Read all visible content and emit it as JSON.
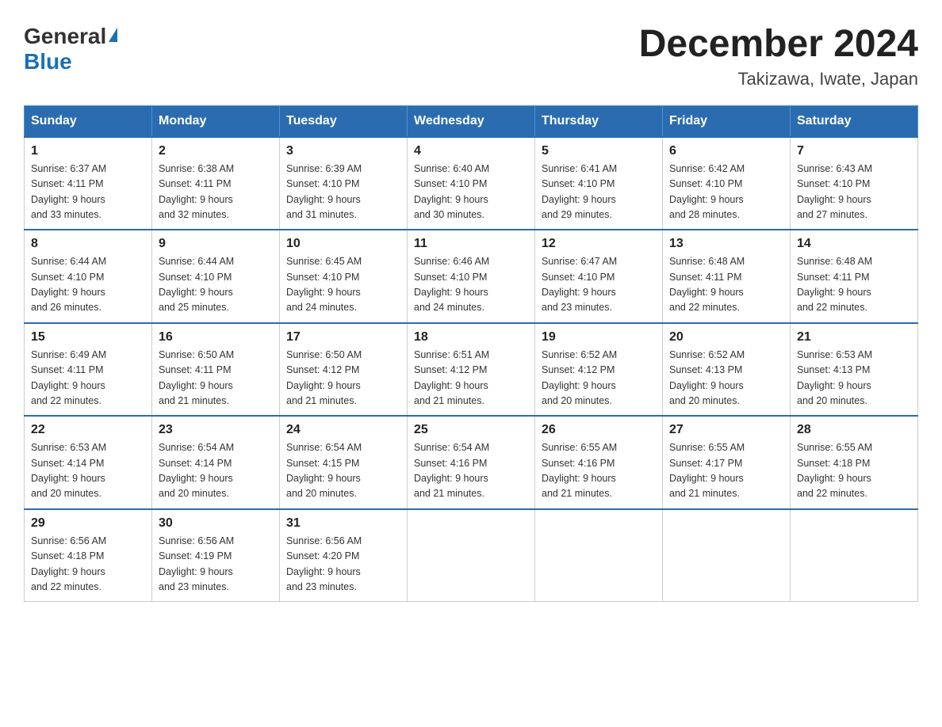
{
  "header": {
    "logo_general": "General",
    "logo_blue": "Blue",
    "month_year": "December 2024",
    "location": "Takizawa, Iwate, Japan"
  },
  "days_of_week": [
    "Sunday",
    "Monday",
    "Tuesday",
    "Wednesday",
    "Thursday",
    "Friday",
    "Saturday"
  ],
  "weeks": [
    [
      {
        "day": "1",
        "sunrise": "6:37 AM",
        "sunset": "4:11 PM",
        "daylight": "9 hours and 33 minutes."
      },
      {
        "day": "2",
        "sunrise": "6:38 AM",
        "sunset": "4:11 PM",
        "daylight": "9 hours and 32 minutes."
      },
      {
        "day": "3",
        "sunrise": "6:39 AM",
        "sunset": "4:10 PM",
        "daylight": "9 hours and 31 minutes."
      },
      {
        "day": "4",
        "sunrise": "6:40 AM",
        "sunset": "4:10 PM",
        "daylight": "9 hours and 30 minutes."
      },
      {
        "day": "5",
        "sunrise": "6:41 AM",
        "sunset": "4:10 PM",
        "daylight": "9 hours and 29 minutes."
      },
      {
        "day": "6",
        "sunrise": "6:42 AM",
        "sunset": "4:10 PM",
        "daylight": "9 hours and 28 minutes."
      },
      {
        "day": "7",
        "sunrise": "6:43 AM",
        "sunset": "4:10 PM",
        "daylight": "9 hours and 27 minutes."
      }
    ],
    [
      {
        "day": "8",
        "sunrise": "6:44 AM",
        "sunset": "4:10 PM",
        "daylight": "9 hours and 26 minutes."
      },
      {
        "day": "9",
        "sunrise": "6:44 AM",
        "sunset": "4:10 PM",
        "daylight": "9 hours and 25 minutes."
      },
      {
        "day": "10",
        "sunrise": "6:45 AM",
        "sunset": "4:10 PM",
        "daylight": "9 hours and 24 minutes."
      },
      {
        "day": "11",
        "sunrise": "6:46 AM",
        "sunset": "4:10 PM",
        "daylight": "9 hours and 24 minutes."
      },
      {
        "day": "12",
        "sunrise": "6:47 AM",
        "sunset": "4:10 PM",
        "daylight": "9 hours and 23 minutes."
      },
      {
        "day": "13",
        "sunrise": "6:48 AM",
        "sunset": "4:11 PM",
        "daylight": "9 hours and 22 minutes."
      },
      {
        "day": "14",
        "sunrise": "6:48 AM",
        "sunset": "4:11 PM",
        "daylight": "9 hours and 22 minutes."
      }
    ],
    [
      {
        "day": "15",
        "sunrise": "6:49 AM",
        "sunset": "4:11 PM",
        "daylight": "9 hours and 22 minutes."
      },
      {
        "day": "16",
        "sunrise": "6:50 AM",
        "sunset": "4:11 PM",
        "daylight": "9 hours and 21 minutes."
      },
      {
        "day": "17",
        "sunrise": "6:50 AM",
        "sunset": "4:12 PM",
        "daylight": "9 hours and 21 minutes."
      },
      {
        "day": "18",
        "sunrise": "6:51 AM",
        "sunset": "4:12 PM",
        "daylight": "9 hours and 21 minutes."
      },
      {
        "day": "19",
        "sunrise": "6:52 AM",
        "sunset": "4:12 PM",
        "daylight": "9 hours and 20 minutes."
      },
      {
        "day": "20",
        "sunrise": "6:52 AM",
        "sunset": "4:13 PM",
        "daylight": "9 hours and 20 minutes."
      },
      {
        "day": "21",
        "sunrise": "6:53 AM",
        "sunset": "4:13 PM",
        "daylight": "9 hours and 20 minutes."
      }
    ],
    [
      {
        "day": "22",
        "sunrise": "6:53 AM",
        "sunset": "4:14 PM",
        "daylight": "9 hours and 20 minutes."
      },
      {
        "day": "23",
        "sunrise": "6:54 AM",
        "sunset": "4:14 PM",
        "daylight": "9 hours and 20 minutes."
      },
      {
        "day": "24",
        "sunrise": "6:54 AM",
        "sunset": "4:15 PM",
        "daylight": "9 hours and 20 minutes."
      },
      {
        "day": "25",
        "sunrise": "6:54 AM",
        "sunset": "4:16 PM",
        "daylight": "9 hours and 21 minutes."
      },
      {
        "day": "26",
        "sunrise": "6:55 AM",
        "sunset": "4:16 PM",
        "daylight": "9 hours and 21 minutes."
      },
      {
        "day": "27",
        "sunrise": "6:55 AM",
        "sunset": "4:17 PM",
        "daylight": "9 hours and 21 minutes."
      },
      {
        "day": "28",
        "sunrise": "6:55 AM",
        "sunset": "4:18 PM",
        "daylight": "9 hours and 22 minutes."
      }
    ],
    [
      {
        "day": "29",
        "sunrise": "6:56 AM",
        "sunset": "4:18 PM",
        "daylight": "9 hours and 22 minutes."
      },
      {
        "day": "30",
        "sunrise": "6:56 AM",
        "sunset": "4:19 PM",
        "daylight": "9 hours and 23 minutes."
      },
      {
        "day": "31",
        "sunrise": "6:56 AM",
        "sunset": "4:20 PM",
        "daylight": "9 hours and 23 minutes."
      },
      null,
      null,
      null,
      null
    ]
  ],
  "labels": {
    "sunrise": "Sunrise:",
    "sunset": "Sunset:",
    "daylight": "Daylight:"
  }
}
